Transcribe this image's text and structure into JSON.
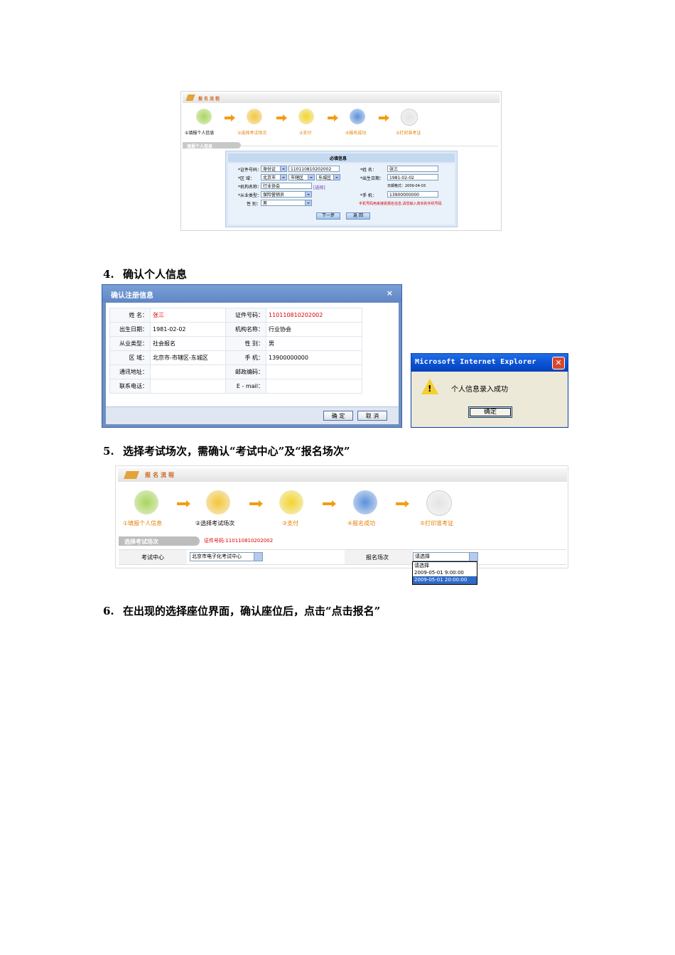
{
  "shot1": {
    "banner_title": "报名流程",
    "steps": [
      "①填报个人信息",
      "②选择考试场次",
      "③支付",
      "④报名成功",
      "⑤打印准考证"
    ],
    "section_label": "填报个人信息",
    "form_title": "必填信息",
    "fields": {
      "id_label": "*证件号码：",
      "id_type": "身份证",
      "id_value": "110110810202002",
      "name_label": "*姓  名：",
      "name_value": "张三",
      "region_label": "*区  域：",
      "region_city": "北京市",
      "region_dist": "市辖区",
      "region_sub": "东城区",
      "birth_label": "*出生日期：",
      "birth_value": "1981-02-02",
      "date_format": "日期格式：2009-04-03",
      "org_label": "*机构名称：",
      "org_value": "行业协会",
      "org_link": "[选择]",
      "job_label": "*从业类型：",
      "job_value": "保险营销员",
      "phone_label": "*手  机：",
      "phone_value": "13900000000",
      "gender_label": "性  别：",
      "gender_value": "男",
      "phone_note": "手机号码用来接受报名信息,请您输入真实的手机号码"
    },
    "btn_next": "下一步",
    "btn_back": "返 回"
  },
  "heading4": {
    "num": "4.",
    "text": "确认个人信息"
  },
  "confirm_dialog": {
    "title": "确认注册信息",
    "close": "×",
    "rows": [
      [
        "姓  名：",
        "张三",
        "证件号码：",
        "110110810202002"
      ],
      [
        "出生日期：",
        "1981-02-02",
        "机构名称：",
        "行业协会"
      ],
      [
        "从业类型：",
        "社会报名",
        "性  别：",
        "男"
      ],
      [
        "区  域：",
        "北京市-市辖区-东城区",
        "手  机：",
        "13900000000"
      ],
      [
        "通讯地址：",
        "",
        "邮政编码：",
        ""
      ],
      [
        "联系电话：",
        "",
        "E - mail：",
        ""
      ]
    ],
    "btn_ok": "确 定",
    "btn_cancel": "取 消"
  },
  "ie_alert": {
    "title": "Microsoft Internet Explorer",
    "close": "✕",
    "message": "个人信息录入成功",
    "ok": "确定"
  },
  "heading5": {
    "num": "5.",
    "text": "选择考试场次，需确认“考试中心”及“报名场次”"
  },
  "shot3": {
    "banner_title": "报名流程",
    "steps": [
      "①填报个人信息",
      "②选择考试场次",
      "③支付",
      "④报名成功",
      "⑤打印准考证"
    ],
    "section_label": "选择考试场次",
    "id_note": "证件号码:110110810202002",
    "center_label": "考试中心",
    "center_value": "北京市电子化考试中心",
    "session_label": "报名场次",
    "session_value": "请选择",
    "session_options": [
      "请选择",
      "2009-05-01 9:00:00",
      "2009-05-01 20:00:00"
    ]
  },
  "heading6": {
    "num": "6.",
    "text": "在出现的选择座位界面，确认座位后，点击“点击报名”"
  },
  "colors": {
    "accent_orange": "#f39c12",
    "dialog_blue": "#6f8fc3",
    "xp_blue": "#0a4fd1",
    "highlight": "#316ac5"
  }
}
